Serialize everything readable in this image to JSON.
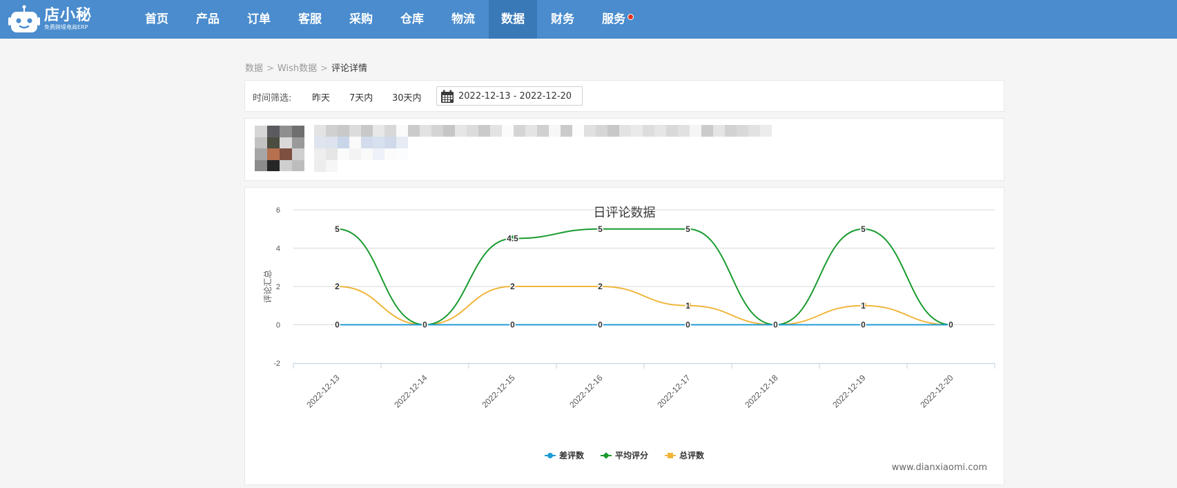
{
  "app": {
    "logo_title": "店小秘",
    "logo_subtitle": "免费跨境电商ERP"
  },
  "nav": {
    "items": [
      {
        "label": "首页"
      },
      {
        "label": "产品"
      },
      {
        "label": "订单"
      },
      {
        "label": "客服"
      },
      {
        "label": "采购"
      },
      {
        "label": "仓库"
      },
      {
        "label": "物流"
      },
      {
        "label": "数据",
        "active": true
      },
      {
        "label": "财务"
      },
      {
        "label": "服务",
        "badge": true
      }
    ],
    "colors": {
      "bar": "#4a8ccd",
      "active": "#3a79b8",
      "badge": "#e5301a"
    }
  },
  "breadcrumb": {
    "items": [
      "数据",
      "Wish数据"
    ],
    "current": "评论详情"
  },
  "filter": {
    "label": "时间筛选:",
    "options": [
      "昨天",
      "7天内",
      "30天内"
    ],
    "date_range": "2022-12-13 - 2022-12-20",
    "icon": "calendar-icon"
  },
  "product": {
    "image": "pixelated-product-thumbnail",
    "text": "blurred-product-info"
  },
  "chart_data": {
    "type": "line",
    "title": "日评论数据",
    "ylabel": "评论汇总",
    "xlabel": "",
    "categories": [
      "2022-12-13",
      "2022-12-14",
      "2022-12-15",
      "2022-12-16",
      "2022-12-17",
      "2022-12-18",
      "2022-12-19",
      "2022-12-20"
    ],
    "ylim": [
      -2,
      6
    ],
    "yticks": [
      -2,
      0,
      2,
      4,
      6
    ],
    "grid": true,
    "legend_position": "bottom-center",
    "series": [
      {
        "name": "差评数",
        "values": [
          0,
          0,
          0,
          0,
          0,
          0,
          0,
          0
        ],
        "color": "#1f9bd7",
        "marker": "circle"
      },
      {
        "name": "平均评分",
        "values": [
          5,
          0,
          4.5,
          5,
          5,
          0,
          5,
          0
        ],
        "color": "#179a2c",
        "marker": "diamond"
      },
      {
        "name": "总评数",
        "values": [
          2,
          0,
          2,
          2,
          1,
          0,
          1,
          0
        ],
        "color": "#f0b53a",
        "marker": "square"
      }
    ],
    "credit": "www.dianxiaomi.com"
  }
}
